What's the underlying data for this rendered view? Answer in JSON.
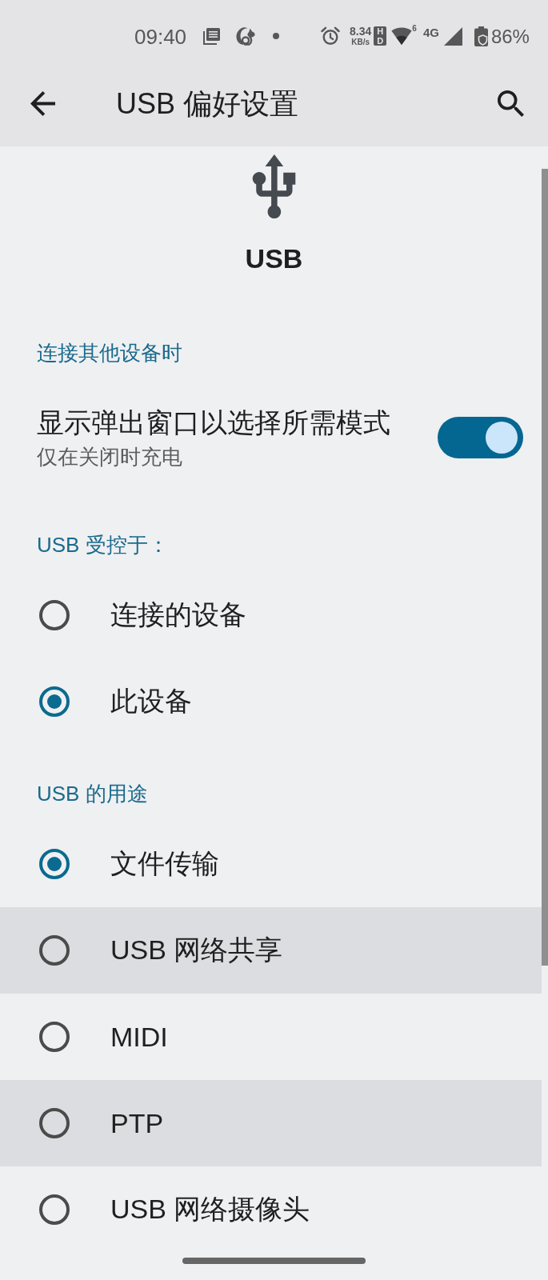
{
  "status_bar": {
    "time": "09:40",
    "net_speed": "8.34",
    "net_speed_unit": "KB/s",
    "hd_badge": "HD",
    "wifi_badge": "6",
    "network_type": "4G",
    "battery": "86%"
  },
  "app_bar": {
    "title": "USB 偏好设置"
  },
  "header": {
    "title": "USB"
  },
  "sections": [
    {
      "title": "连接其他设备时",
      "items": [
        {
          "kind": "switch",
          "title": "显示弹出窗口以选择所需模式",
          "summary": "仅在关闭时充电",
          "on": true
        }
      ]
    },
    {
      "title": "USB 受控于：",
      "items": [
        {
          "kind": "radio",
          "label": "连接的设备",
          "selected": false,
          "highlighted": false
        },
        {
          "kind": "radio",
          "label": "此设备",
          "selected": true,
          "highlighted": false
        }
      ]
    },
    {
      "title": "USB 的用途",
      "items": [
        {
          "kind": "radio",
          "label": "文件传输",
          "selected": true,
          "highlighted": false
        },
        {
          "kind": "radio",
          "label": "USB 网络共享",
          "selected": false,
          "highlighted": true
        },
        {
          "kind": "radio",
          "label": "MIDI",
          "selected": false,
          "highlighted": false
        },
        {
          "kind": "radio",
          "label": "PTP",
          "selected": false,
          "highlighted": true
        },
        {
          "kind": "radio",
          "label": "USB 网络摄像头",
          "selected": false,
          "highlighted": false
        }
      ]
    }
  ]
}
